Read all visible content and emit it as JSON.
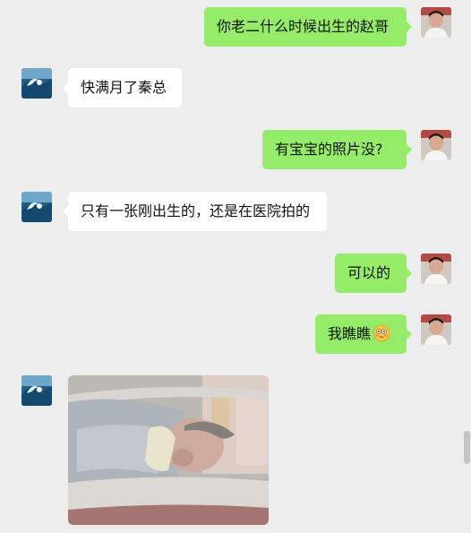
{
  "chat": {
    "messages": [
      {
        "side": "right",
        "text": "你老二什么时候出生的赵哥"
      },
      {
        "side": "left",
        "text": "快满月了秦总"
      },
      {
        "side": "right",
        "text": "有宝宝的照片没?"
      },
      {
        "side": "left",
        "text": "只有一张刚出生的，还是在医院拍的"
      },
      {
        "side": "right",
        "text": "可以的"
      },
      {
        "side": "right",
        "text": "我瞧瞧",
        "emoji": "flushed-face-emoji"
      },
      {
        "side": "left",
        "type": "image",
        "image": "newborn-baby-photo"
      }
    ]
  },
  "colors": {
    "background": "#ededed",
    "sent_bubble": "#95ec69",
    "received_bubble": "#ffffff"
  }
}
